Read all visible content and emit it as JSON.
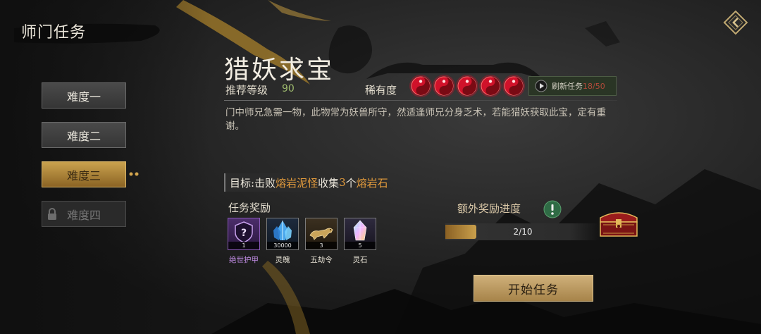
{
  "header": {
    "title": "师门任务"
  },
  "tabs": [
    {
      "label": "难度一",
      "state": "normal"
    },
    {
      "label": "难度二",
      "state": "normal"
    },
    {
      "label": "难度三",
      "state": "active"
    },
    {
      "label": "难度四",
      "state": "locked"
    }
  ],
  "quest": {
    "title": "猎妖求宝",
    "recommended_level_label": "推荐等级",
    "recommended_level_value": "90",
    "rarity_label": "稀有度",
    "rarity_count": 5,
    "refresh_label": "刷新任务",
    "refresh_count": "18/50",
    "description": "门中师兄急需一物，此物常为妖兽所守，然适逢师兄分身乏术，若能猎妖获取此宝，定有重谢。",
    "goal": {
      "prefix": "目标:",
      "verb1": "击败",
      "target1": "熔岩泥怪",
      "verb2": "收集",
      "count": "3",
      "unit": "个",
      "target2": "熔岩石"
    }
  },
  "rewards": {
    "title": "任务奖励",
    "items": [
      {
        "name": "绝世护甲",
        "qty": "1",
        "icon": "mystery-armor-icon",
        "rarity_color": "#c48ee8"
      },
      {
        "name": "灵魄",
        "qty": "30000",
        "icon": "blue-crystal-icon"
      },
      {
        "name": "五劫令",
        "qty": "3",
        "icon": "golden-beast-icon"
      },
      {
        "name": "灵石",
        "qty": "5",
        "icon": "spirit-stone-icon"
      }
    ]
  },
  "extra_reward": {
    "label": "额外奖励进度",
    "progress_text": "2/10",
    "progress_fraction": 0.2
  },
  "start_button": {
    "label": "开始任务"
  },
  "colors": {
    "accent_gold": "#caa24e",
    "highlight_orange": "#e39b3c",
    "level_green": "#9fbc6e",
    "rarity_red": "#d0122a"
  }
}
